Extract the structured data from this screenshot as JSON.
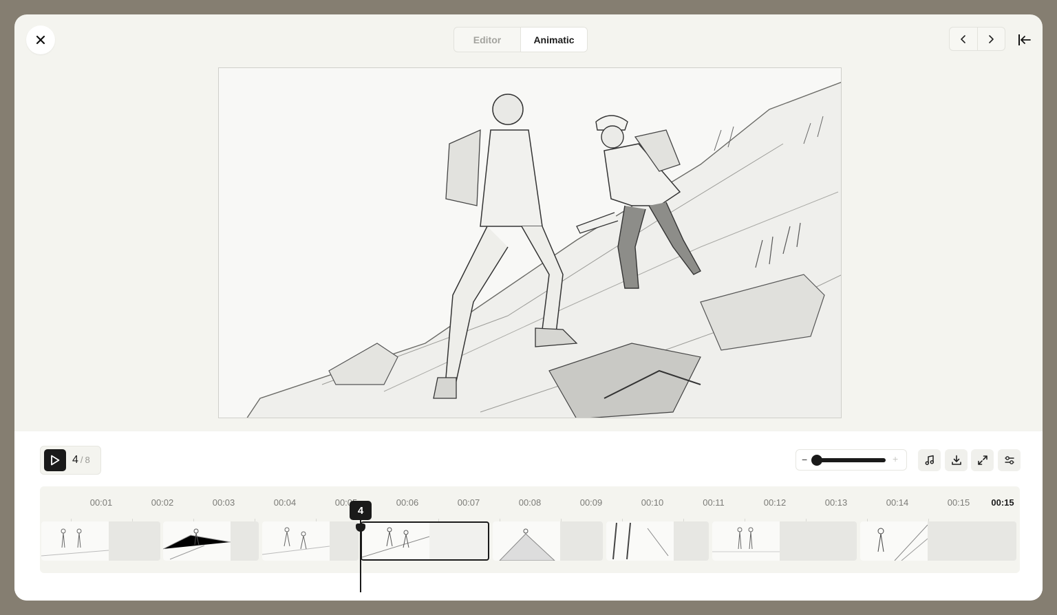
{
  "header": {
    "tabs": [
      {
        "label": "Editor",
        "active": false
      },
      {
        "label": "Animatic",
        "active": true
      }
    ],
    "icons": {
      "close": "close-icon",
      "prev": "chevron-left-icon",
      "next": "chevron-right-icon",
      "collapse": "collapse-panel-icon"
    }
  },
  "preview": {
    "description_icon": "storyboard-sketch-image"
  },
  "playback": {
    "current_frame": "4",
    "total_frames": "8",
    "separator": "/",
    "zoom_level": 0.0
  },
  "toolbar": {
    "zoom_minus": "−",
    "zoom_plus": "+",
    "icons": [
      "music-icon",
      "download-icon",
      "fullscreen-icon",
      "settings-sliders-icon"
    ]
  },
  "timeline": {
    "ticks": [
      "00:01",
      "00:02",
      "00:03",
      "00:04",
      "00:05",
      "00:06",
      "00:07",
      "00:08",
      "00:09",
      "00:10",
      "00:11",
      "00:12",
      "00:13",
      "00:14",
      "00:15",
      "00:15"
    ],
    "playhead_label": "4",
    "clips": [
      {
        "frame": 1,
        "active": false
      },
      {
        "frame": 2,
        "active": false
      },
      {
        "frame": 3,
        "active": false
      },
      {
        "frame": 4,
        "active": true
      },
      {
        "frame": 5,
        "active": false
      },
      {
        "frame": 6,
        "active": false
      },
      {
        "frame": 7,
        "active": false
      },
      {
        "frame": 8,
        "active": false
      }
    ]
  },
  "colors": {
    "backdrop": "#857e71",
    "panel": "#f4f4ef",
    "accent": "#1a1a1a"
  }
}
